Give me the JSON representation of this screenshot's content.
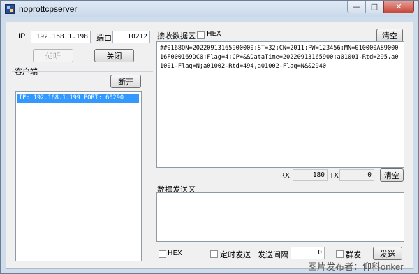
{
  "window": {
    "title": "noprottcpserver",
    "min_glyph": "—",
    "max_glyph": "□",
    "close_glyph": "✕"
  },
  "connection": {
    "ip_label": "IP",
    "ip_value": "192.168.1.198",
    "port_label": "端口",
    "port_value": "10212",
    "listen_button": "侦听",
    "close_button": "关闭"
  },
  "clients": {
    "group_label": "客户端",
    "disconnect_button": "断开",
    "items": [
      "IP: 192.168.1.199 PORT: 60290"
    ]
  },
  "receive": {
    "title": "接收数据区",
    "hex_label": "HEX",
    "clear_button": "清空",
    "content": "##0168QN=20220913165900000;ST=32;CN=2011;PW=123456;MN=010000A8900016F000169DC0;Flag=4;CP=&&DataTime=20220913165900;a01001-Rtd=295,a01001-Flag=N;a01002-Rtd=494,a01002-Flag=N&&2940"
  },
  "counters": {
    "rx_label": "RX",
    "rx_value": "180",
    "tx_label": "TX",
    "tx_value": "0",
    "clear_button": "清空"
  },
  "send": {
    "title": "数据发送区",
    "content": "",
    "hex_label": "HEX",
    "timer_label": "定时发送",
    "interval_label": "发送间隔",
    "interval_value": "0",
    "group_label": "群发",
    "send_button": "发送"
  },
  "watermark": "图片发布者：仰科onker"
}
